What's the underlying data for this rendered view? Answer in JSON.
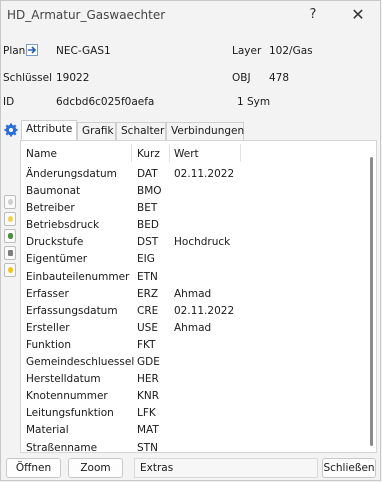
{
  "window": {
    "title": "HD_Armatur_Gaswaechter",
    "help_glyph": "?",
    "close_glyph": "✕"
  },
  "header": {
    "plan_label": "Plan",
    "plan_value": "NEC-GAS1",
    "layer_label": "Layer",
    "layer_value": "102/Gas",
    "schluessel_label": "Schlüssel",
    "schluessel_value": "19022",
    "obj_label": "OBJ",
    "obj_value": "478",
    "id_label": "ID",
    "id_value": "6dcbd6c025f0aefa",
    "sym_value": "1 Sym"
  },
  "tabs": [
    "Attribute",
    "Grafik",
    "Schalter",
    "Verbindungen"
  ],
  "active_tab": "Attribute",
  "table": {
    "headers": {
      "name": "Name",
      "kurz": "Kurz",
      "wert": "Wert"
    },
    "rows": [
      {
        "name": "Änderungsdatum",
        "kurz": "DAT",
        "wert": "02.11.2022"
      },
      {
        "name": "Baumonat",
        "kurz": "BMO",
        "wert": ""
      },
      {
        "name": "Betreiber",
        "kurz": "BET",
        "wert": ""
      },
      {
        "name": "Betriebsdruck",
        "kurz": "BED",
        "wert": ""
      },
      {
        "name": "Druckstufe",
        "kurz": "DST",
        "wert": "Hochdruck"
      },
      {
        "name": "Eigentümer",
        "kurz": "EIG",
        "wert": ""
      },
      {
        "name": "Einbauteilenummer",
        "kurz": "ETN",
        "wert": ""
      },
      {
        "name": "Erfasser",
        "kurz": "ERZ",
        "wert": "Ahmad"
      },
      {
        "name": "Erfassungsdatum",
        "kurz": "CRE",
        "wert": "02.11.2022"
      },
      {
        "name": "Ersteller",
        "kurz": "USE",
        "wert": "Ahmad"
      },
      {
        "name": "Funktion",
        "kurz": "FKT",
        "wert": ""
      },
      {
        "name": "Gemeindeschluessel",
        "kurz": "GDE",
        "wert": ""
      },
      {
        "name": "Herstelldatum",
        "kurz": "HER",
        "wert": ""
      },
      {
        "name": "Knotennummer",
        "kurz": "KNR",
        "wert": ""
      },
      {
        "name": "Leitungsfunktion",
        "kurz": "LFK",
        "wert": ""
      },
      {
        "name": "Material",
        "kurz": "MAT",
        "wert": ""
      },
      {
        "name": "Straßenname",
        "kurz": "STN",
        "wert": ""
      }
    ]
  },
  "buttons": {
    "open": "Öffnen",
    "zoom": "Zoom",
    "extras": "Extras",
    "close": "Schließen"
  },
  "icons": {
    "gear": "gear-icon",
    "plan_arrow": "arrow-right-icon",
    "side": [
      "lightbulb-off-icon",
      "lightbulb-on-icon",
      "eye-icon",
      "printer-icon",
      "lightbulb-yellow-icon"
    ]
  }
}
